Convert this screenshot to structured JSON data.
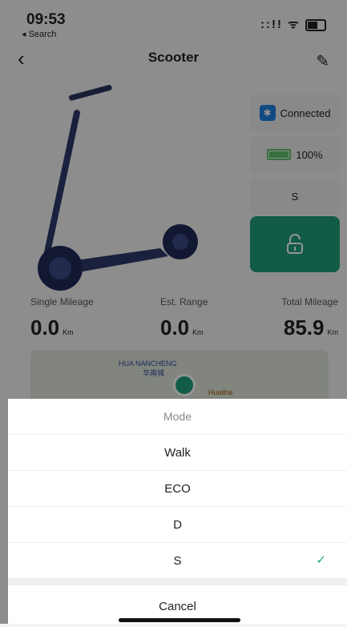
{
  "status_bar": {
    "time": "09:53",
    "back_app": "◂ Search",
    "icons": "::!! ᯤ"
  },
  "nav": {
    "back_icon": "‹",
    "title": "Scooter",
    "edit_icon": "✎"
  },
  "device": {
    "connection": "Connected",
    "battery": "100%",
    "mode": "S",
    "lock_icon": "unlock"
  },
  "stats": [
    {
      "label": "Single Mileage",
      "value": "0.0",
      "unit": "Km"
    },
    {
      "label": "Est. Range",
      "value": "0.0",
      "unit": "Km"
    },
    {
      "label": "Total Mileage",
      "value": "85.9",
      "unit": "Km"
    }
  ],
  "map": {
    "label_en": "HUA NANCHENG",
    "label_cn": "华南城",
    "label_poi": "Hualihe"
  },
  "mode_sheet": {
    "title": "Mode",
    "options": [
      "Walk",
      "ECO",
      "D",
      "S"
    ],
    "selected": "S",
    "cancel": "Cancel"
  },
  "colors": {
    "accent": "#1e9e7a",
    "bluetooth": "#1e7fe0",
    "battery": "#5ec26a"
  }
}
